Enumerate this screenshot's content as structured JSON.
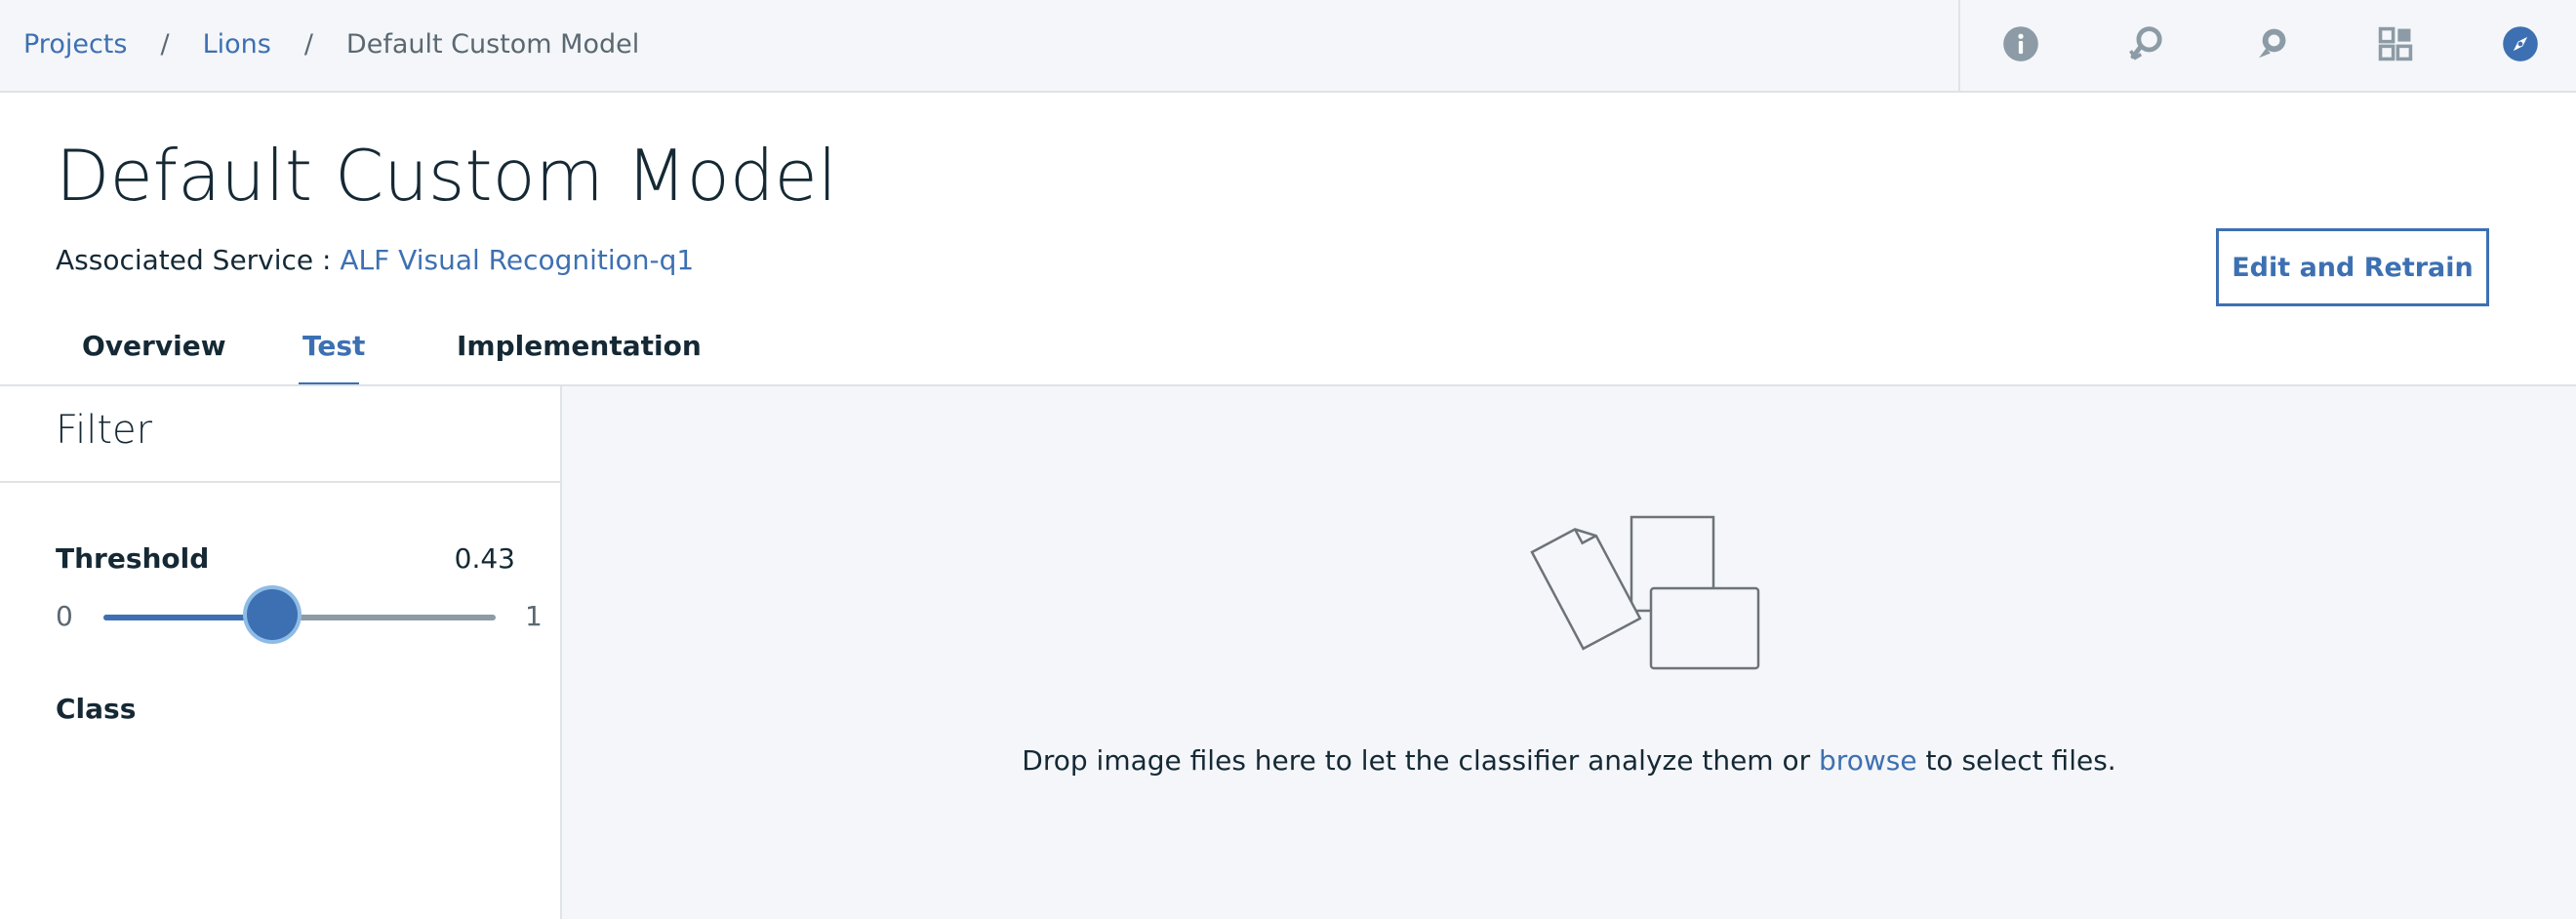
{
  "breadcrumb": {
    "items": [
      "Projects",
      "Lions"
    ],
    "separator": "/",
    "current": "Default Custom Model"
  },
  "toolbar": {
    "icons": [
      "info-icon",
      "pin-refresh-icon",
      "chat-icon",
      "apps-icon",
      "compass-icon"
    ]
  },
  "header": {
    "title": "Default Custom Model",
    "associated_label": "Associated Service :",
    "associated_link": "ALF Visual Recognition-q1",
    "edit_button": "Edit and Retrain"
  },
  "tabs": [
    {
      "label": "Overview",
      "active": false
    },
    {
      "label": "Test",
      "active": true
    },
    {
      "label": "Implementation",
      "active": false
    }
  ],
  "filter": {
    "title": "Filter",
    "threshold_label": "Threshold",
    "threshold_value": "0.43",
    "threshold_fraction": 0.43,
    "slider_min": "0",
    "slider_max": "1",
    "class_label": "Class"
  },
  "dropzone": {
    "text_before": "Drop image files here to let the classifier analyze them or",
    "link": "browse",
    "text_after": "to select files."
  },
  "colors": {
    "accent": "#3d70b2",
    "topbar_bg": "#f4f6f9",
    "text": "#152935",
    "muted": "#5a6872",
    "slider_thumb_ring": "#8fbce6"
  }
}
